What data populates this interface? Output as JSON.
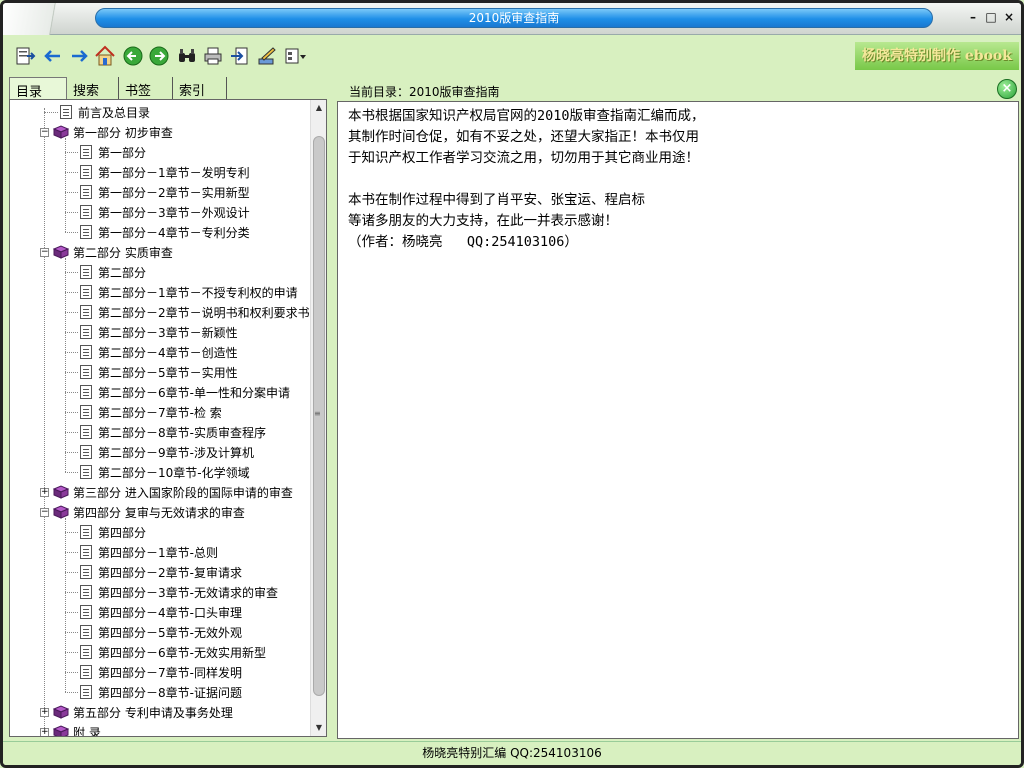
{
  "window": {
    "title": "2010版审查指南",
    "controls": [
      "–",
      "□",
      "×"
    ]
  },
  "toolbar": {
    "buttons": [
      "toc-icon",
      "back-arrow-icon",
      "forward-arrow-icon",
      "home-icon",
      "prev-page-icon",
      "next-page-icon",
      "find-icon",
      "print-icon",
      "exit-icon",
      "edit-icon",
      "options-icon"
    ],
    "brand": "杨晓亮特别制作 ebook"
  },
  "tabs": [
    "目录",
    "搜索",
    "书签",
    "索引"
  ],
  "tree": [
    {
      "label": "前言及总目录",
      "type": "page",
      "level": 0
    },
    {
      "label": "第一部分 初步审查",
      "type": "book",
      "level": 0,
      "expanded": true
    },
    {
      "label": "第一部分",
      "type": "page",
      "level": 1
    },
    {
      "label": "第一部分－1章节－发明专利",
      "type": "page",
      "level": 1
    },
    {
      "label": "第一部分－2章节－实用新型",
      "type": "page",
      "level": 1
    },
    {
      "label": "第一部分－3章节－外观设计",
      "type": "page",
      "level": 1
    },
    {
      "label": "第一部分－4章节－专利分类",
      "type": "page",
      "level": 1
    },
    {
      "label": "第二部分 实质审查",
      "type": "book",
      "level": 0,
      "expanded": true
    },
    {
      "label": "第二部分",
      "type": "page",
      "level": 1
    },
    {
      "label": "第二部分－1章节－不授专利权的申请",
      "type": "page",
      "level": 1
    },
    {
      "label": "第二部分－2章节－说明书和权利要求书",
      "type": "page",
      "level": 1
    },
    {
      "label": "第二部分－3章节－新颖性",
      "type": "page",
      "level": 1
    },
    {
      "label": "第二部分－4章节－创造性",
      "type": "page",
      "level": 1
    },
    {
      "label": "第二部分－5章节－实用性",
      "type": "page",
      "level": 1
    },
    {
      "label": "第二部分－6章节-单一性和分案申请",
      "type": "page",
      "level": 1
    },
    {
      "label": "第二部分－7章节-检  索",
      "type": "page",
      "level": 1
    },
    {
      "label": "第二部分－8章节-实质审查程序",
      "type": "page",
      "level": 1
    },
    {
      "label": "第二部分－9章节-涉及计算机",
      "type": "page",
      "level": 1
    },
    {
      "label": "第二部分－10章节-化学领域",
      "type": "page",
      "level": 1
    },
    {
      "label": "第三部分 进入国家阶段的国际申请的审查",
      "type": "book",
      "level": 0,
      "expanded": false
    },
    {
      "label": "第四部分 复审与无效请求的审查",
      "type": "book",
      "level": 0,
      "expanded": true
    },
    {
      "label": "第四部分",
      "type": "page",
      "level": 1
    },
    {
      "label": "第四部分－1章节-总则",
      "type": "page",
      "level": 1
    },
    {
      "label": "第四部分－2章节-复审请求",
      "type": "page",
      "level": 1
    },
    {
      "label": "第四部分－3章节-无效请求的审查",
      "type": "page",
      "level": 1
    },
    {
      "label": "第四部分－4章节-口头审理",
      "type": "page",
      "level": 1
    },
    {
      "label": "第四部分－5章节-无效外观",
      "type": "page",
      "level": 1
    },
    {
      "label": "第四部分－6章节-无效实用新型",
      "type": "page",
      "level": 1
    },
    {
      "label": "第四部分－7章节-同样发明",
      "type": "page",
      "level": 1
    },
    {
      "label": "第四部分－8章节-证据问题",
      "type": "page",
      "level": 1
    },
    {
      "label": "第五部分 专利申请及事务处理",
      "type": "book",
      "level": 0,
      "expanded": false
    },
    {
      "label": "附 录",
      "type": "book",
      "level": 0,
      "expanded": false
    }
  ],
  "content": {
    "breadcrumb": "当前目录：2010版审查指南",
    "lines": [
      "本书根据国家知识产权局官网的2010版审查指南汇编而成，",
      "其制作时间仓促，如有不妥之处，还望大家指正！本书仅用",
      "于知识产权工作者学习交流之用，切勿用于其它商业用途！",
      "",
      "本书在制作过程中得到了肖平安、张宝运、程启标",
      "等诸多朋友的大力支持，在此一并表示感谢！",
      "（作者：杨晓亮   QQ:254103106）"
    ]
  },
  "status": "杨晓亮特别汇编 QQ:254103106",
  "colors": {
    "background": "#d8f0c0",
    "title_pill": "#1f8fe8",
    "book_icon": "#7a2a8a"
  }
}
